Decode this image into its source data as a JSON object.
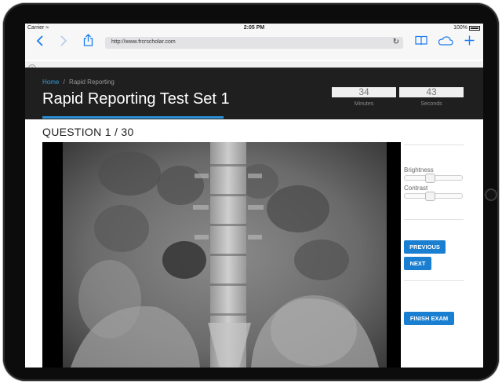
{
  "status_bar": {
    "carrier": "Carrier",
    "time": "2:05 PM",
    "battery": "100%"
  },
  "browser": {
    "url": "http://www.frcrscholar.com"
  },
  "icons": {
    "back": "chevron-left-icon",
    "forward": "chevron-right-icon",
    "share": "share-icon",
    "reload": "reload-icon",
    "bookmarks": "book-icon",
    "cloud": "cloud-icon",
    "new_tab": "plus-icon"
  },
  "breadcrumb": {
    "home": "Home",
    "separator": "/",
    "current": "Rapid Reporting"
  },
  "page_title": "Rapid Reporting Test Set 1",
  "timer": {
    "minutes": "34",
    "minutes_label": "Minutes",
    "seconds": "43",
    "seconds_label": "Seconds"
  },
  "question": {
    "label": "QUESTION 1 / 30"
  },
  "controls": {
    "brightness_label": "Brightness",
    "contrast_label": "Contrast"
  },
  "buttons": {
    "previous": "PREVIOUS",
    "next": "NEXT",
    "finish": "FINISH EXAM"
  },
  "colors": {
    "accent": "#2d8fd5",
    "button": "#1b7fd1",
    "header": "#1f1f1f"
  }
}
